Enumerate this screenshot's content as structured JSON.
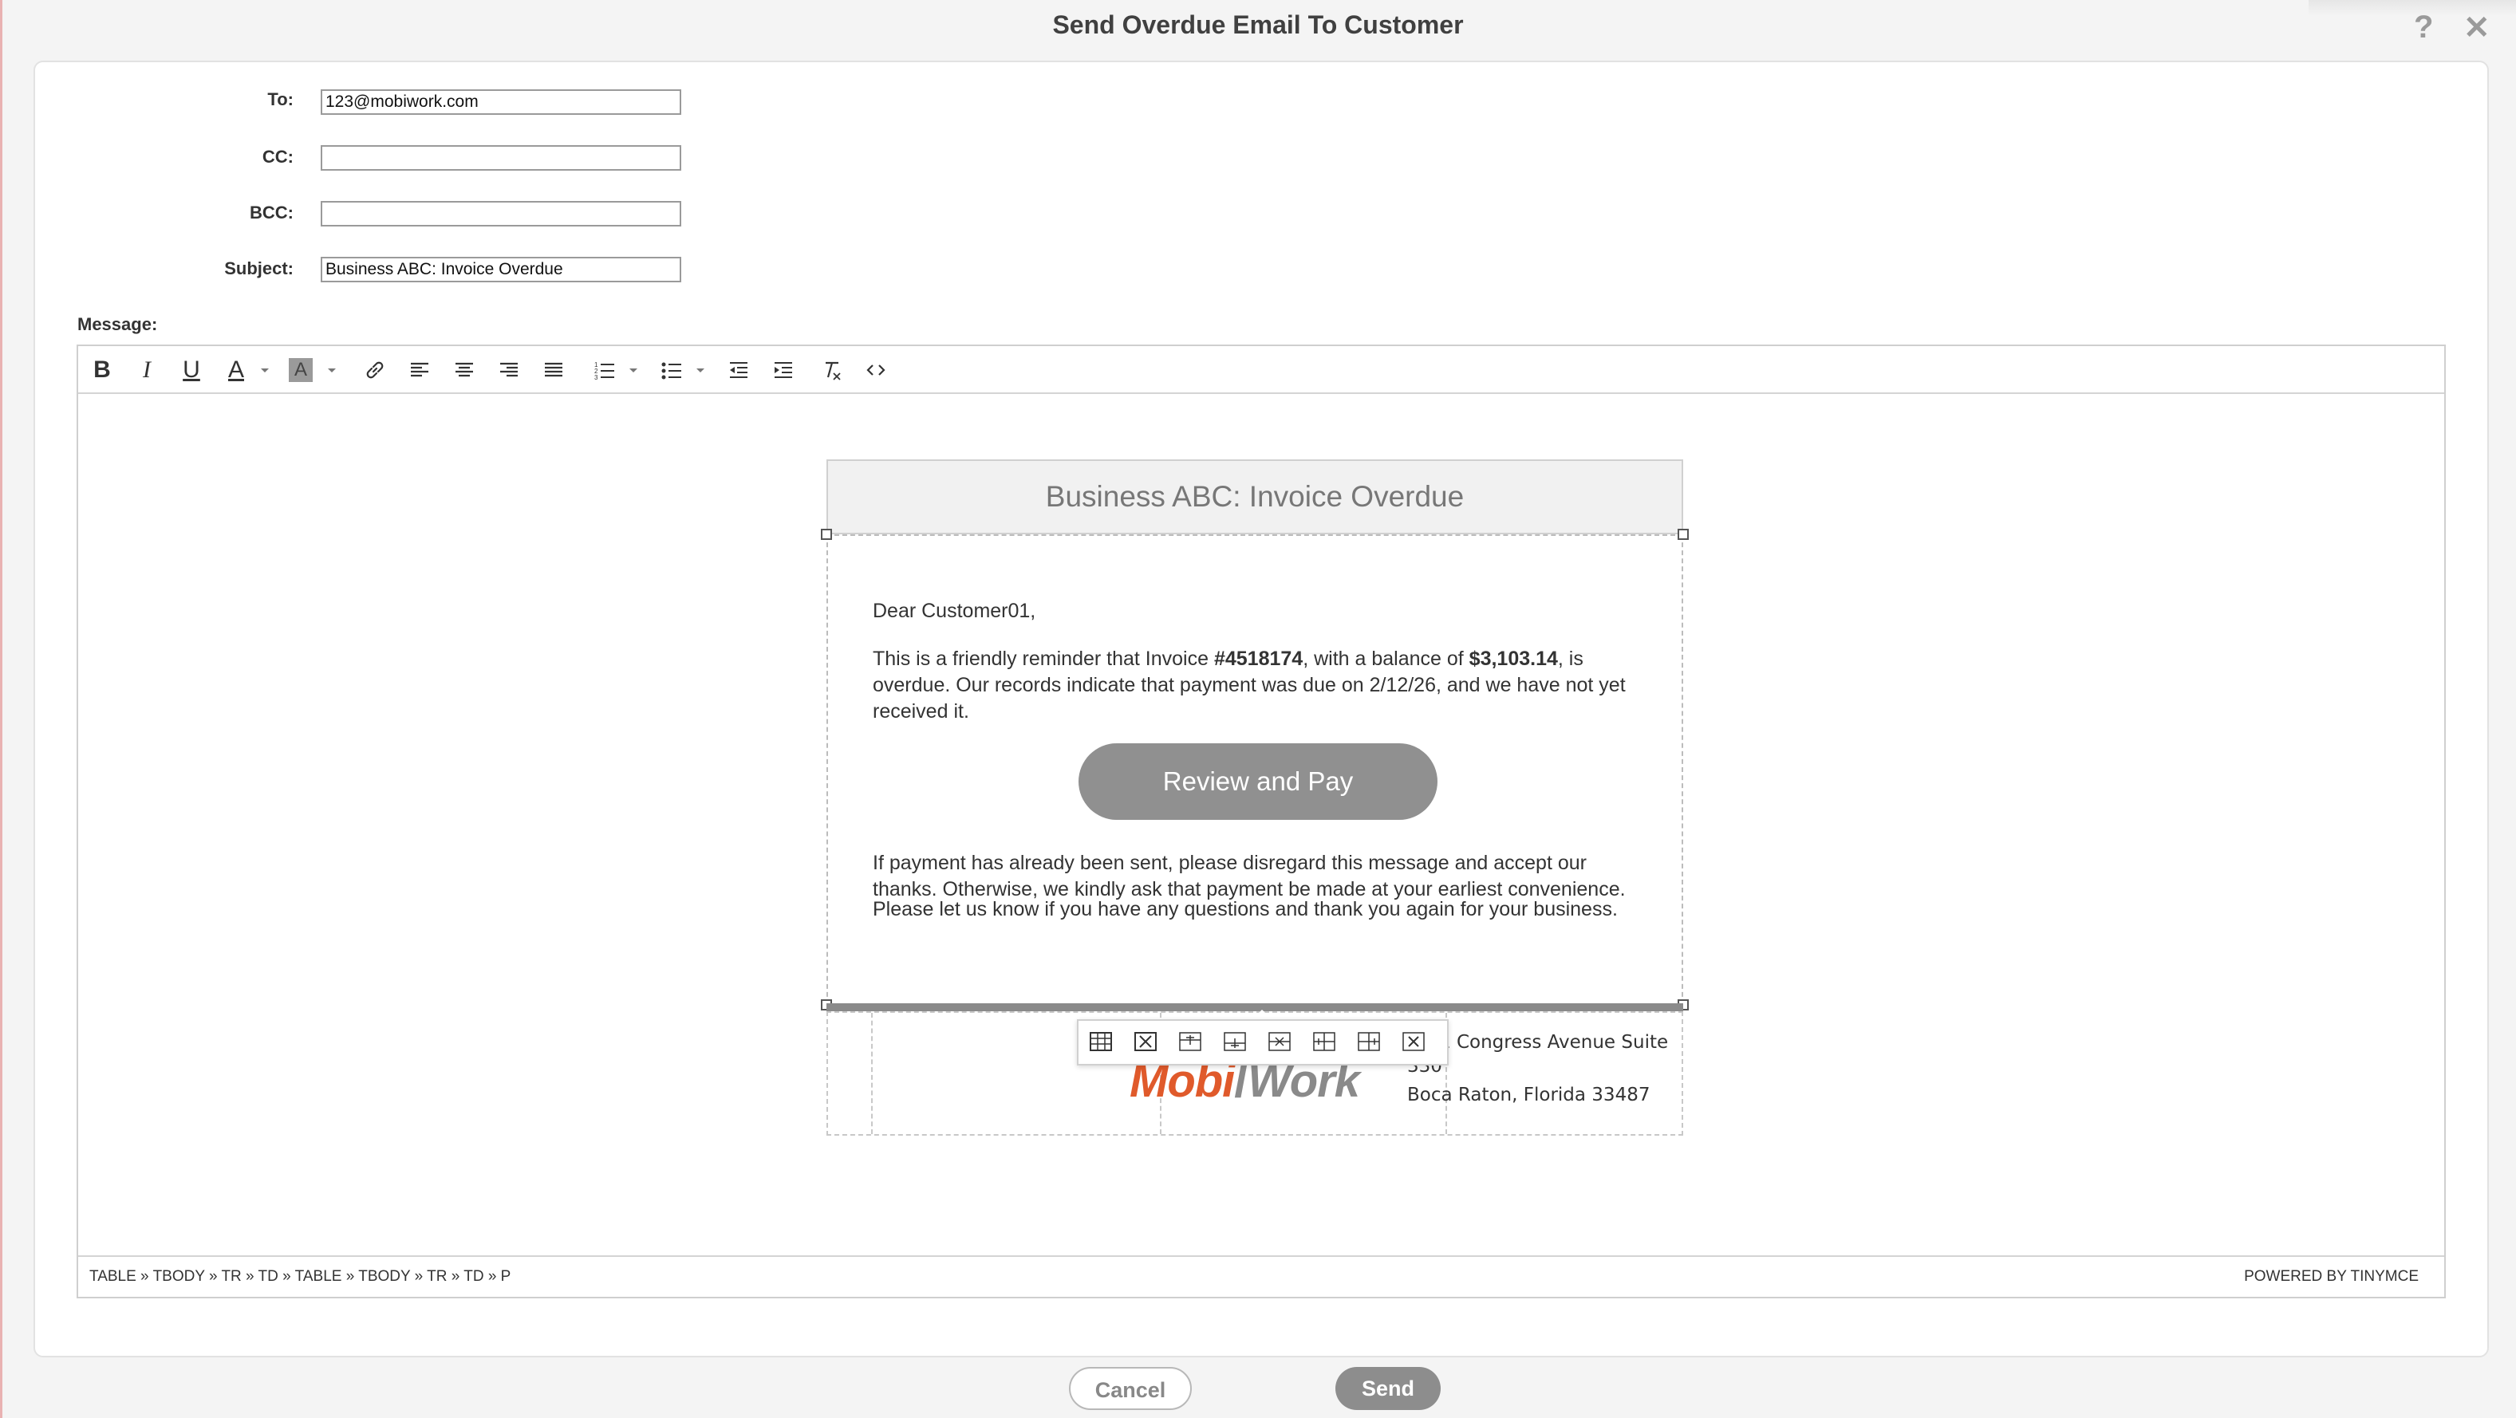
{
  "dialog": {
    "title": "Send Overdue Email To Customer",
    "help_icon": "question-mark-icon",
    "close_icon": "close-icon"
  },
  "form": {
    "to_label": "To:",
    "to_value": "123@mobiwork.com",
    "cc_label": "CC:",
    "cc_value": "",
    "bcc_label": "BCC:",
    "bcc_value": "",
    "subject_label": "Subject:",
    "subject_value": "Business ABC: Invoice Overdue",
    "message_label": "Message:"
  },
  "toolbar": {
    "icons": [
      "bold-icon",
      "italic-icon",
      "underline-icon",
      "text-color-icon",
      "background-color-icon",
      "link-icon",
      "align-left-icon",
      "align-center-icon",
      "align-right-icon",
      "justify-icon",
      "numbered-list-icon",
      "bullet-list-icon",
      "outdent-icon",
      "indent-icon",
      "clear-formatting-icon",
      "source-code-icon"
    ]
  },
  "email": {
    "header": "Business ABC: Invoice Overdue",
    "greeting": "Dear Customer01,",
    "p1_a": "This is a friendly reminder that Invoice ",
    "p1_invoice": "#4518174",
    "p1_b": ", with a balance of ",
    "p1_amount": "$3,103.14",
    "p1_c": ", is overdue. Our records indicate that payment was due on 2/12/26, and we have not yet received it.",
    "pay_button": "Review and Pay",
    "p2": "If payment has already been sent, please disregard this message and accept our thanks. Otherwise, we kindly ask that payment be made at your earliest convenience.",
    "p3": "Please let us know if you have any questions and thank you again for your business.",
    "logo_mobi": "Mobi",
    "logo_work": "Work",
    "address_line1": "1 Congress Avenue Suite",
    "address_line2": "330",
    "address_line3": "Boca Raton, Florida 33487"
  },
  "table_toolbar": {
    "icons": [
      "table-properties-icon",
      "delete-table-icon",
      "insert-row-before-icon",
      "insert-row-after-icon",
      "delete-row-icon",
      "insert-column-before-icon",
      "insert-column-after-icon",
      "delete-column-icon"
    ]
  },
  "statusbar": {
    "path": "TABLE » TBODY » TR » TD » TABLE » TBODY » TR » TD » P",
    "powered": "POWERED BY TINYMCE"
  },
  "buttons": {
    "cancel": "Cancel",
    "send": "Send"
  },
  "colors": {
    "logo_orange": "#e05a2b",
    "logo_gray": "#8a8a8a",
    "button_gray": "#909090"
  }
}
